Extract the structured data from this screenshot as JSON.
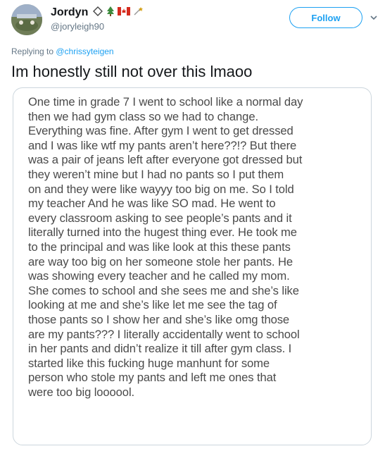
{
  "tweet": {
    "display_name": "Jordyn",
    "handle": "@joryleigh90",
    "name_emojis": [
      "loop-icon",
      "tree-icon",
      "canada-flag-icon",
      "sparkle-icon"
    ],
    "follow_label": "Follow",
    "reply_prefix": "Replying to ",
    "reply_to": "@chrissyteigen",
    "text": "Im honestly still not over this lmaoo"
  },
  "media": {
    "note_text": "One time in grade 7 I went to school like a normal day\nthen we had gym class so we had to change.\nEverything was fine. After gym I went to get dressed\nand I was like wtf my pants aren’t here??!? But there\nwas a pair of jeans left after everyone got dressed but\nthey weren’t mine but I had no pants so I put them\non and they were like wayyy too big on me. So I told\nmy teacher And he was like SO mad. He went to\nevery classroom asking to see people’s pants and it\nliterally turned into the hugest thing ever. He took me\nto the principal and was like look at this these pants\nare way too big on her someone stole her pants. He\nwas showing every teacher  and he called my mom.\nShe comes to school and she sees me and she’s like\nlooking at me and she’s like let me see the tag of\nthose pants so I show her and she’s like omg those\nare my pants??? I literally accidentally went to school\nin her pants and didn’t realize it till after gym class. I\nstarted like this fucking huge manhunt for some\nperson who stole my pants and left me ones that\nwere too big loooool."
  },
  "colors": {
    "accent": "#1da1f2",
    "secondary_text": "#657786",
    "primary_text": "#14171a",
    "card_border": "#ccd6dd"
  }
}
